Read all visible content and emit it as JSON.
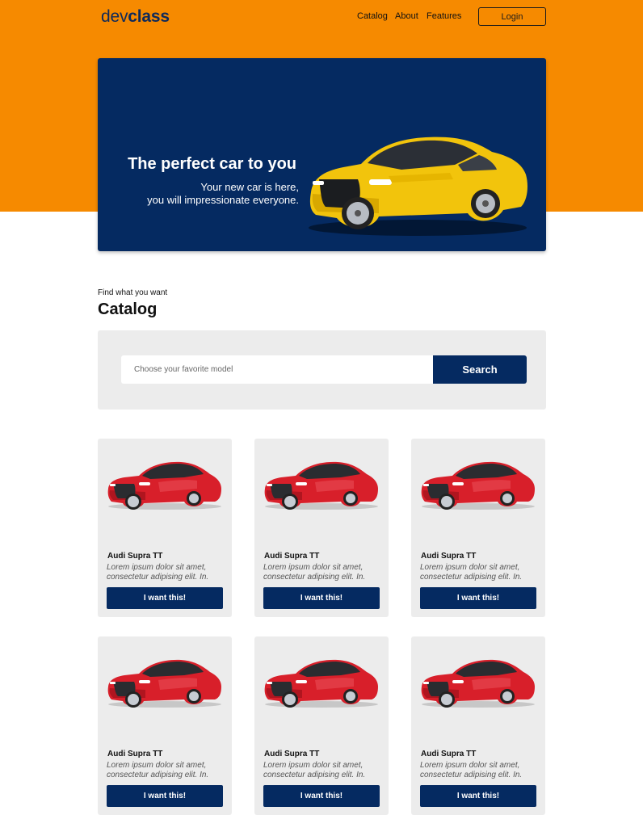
{
  "header": {
    "logo_light": "dev",
    "logo_bold": "class",
    "nav": [
      "Catalog",
      "About",
      "Features"
    ],
    "login_label": "Login"
  },
  "hero": {
    "title": "The perfect car to you",
    "subtitle_line1": "Your new car is here,",
    "subtitle_line2": "you will impressionate everyone."
  },
  "catalog": {
    "kicker": "Find what you want",
    "title": "Catalog",
    "search": {
      "placeholder": "Choose your favorite model",
      "button_label": "Search"
    },
    "cards": [
      {
        "name": "Audi Supra TT",
        "desc_line1": "Lorem ipsum dolor sit amet,",
        "desc_line2": "consectetur adipising elit. In.",
        "button_label": "I want this!"
      },
      {
        "name": "Audi Supra TT",
        "desc_line1": "Lorem ipsum dolor sit amet,",
        "desc_line2": "consectetur adipising elit. In.",
        "button_label": "I want this!"
      },
      {
        "name": "Audi Supra TT",
        "desc_line1": "Lorem ipsum dolor sit amet,",
        "desc_line2": "consectetur adipising elit. In.",
        "button_label": "I want this!"
      },
      {
        "name": "Audi Supra TT",
        "desc_line1": "Lorem ipsum dolor sit amet,",
        "desc_line2": "consectetur adipising elit. In.",
        "button_label": "I want this!"
      },
      {
        "name": "Audi Supra TT",
        "desc_line1": "Lorem ipsum dolor sit amet,",
        "desc_line2": "consectetur adipising elit. In.",
        "button_label": "I want this!"
      },
      {
        "name": "Audi Supra TT",
        "desc_line1": "Lorem ipsum dolor sit amet,",
        "desc_line2": "consectetur adipising elit. In.",
        "button_label": "I want this!"
      }
    ]
  },
  "colors": {
    "brand_orange": "#f68a00",
    "brand_navy": "#052a61",
    "panel_gray": "#ececec",
    "hero_car": "#f2c40c",
    "card_car": "#d81f2a"
  }
}
